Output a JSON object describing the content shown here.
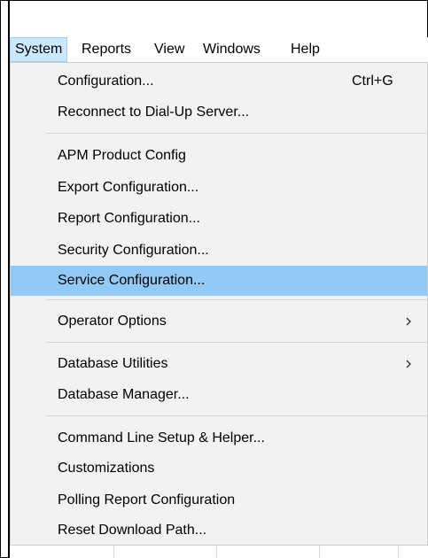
{
  "menubar": {
    "items": [
      {
        "label": "System",
        "open": true
      },
      {
        "label": "Reports",
        "open": false
      },
      {
        "label": "View",
        "open": false
      },
      {
        "label": "Windows",
        "open": false
      },
      {
        "label": "Help",
        "open": false
      }
    ]
  },
  "system_menu": {
    "items": [
      {
        "label": "Configuration...",
        "shortcut": "Ctrl+G"
      },
      {
        "label": "Reconnect to Dial-Up Server..."
      },
      {
        "label": "APM Product Config"
      },
      {
        "label": "Export Configuration..."
      },
      {
        "label": "Report Configuration..."
      },
      {
        "label": "Security Configuration..."
      },
      {
        "label": "Service Configuration...",
        "highlighted": true
      },
      {
        "label": "Operator Options",
        "submenu_icon": "chevron-right-icon"
      },
      {
        "label": "Database Utilities",
        "submenu_icon": "chevron-right-icon"
      },
      {
        "label": "Database Manager..."
      },
      {
        "label": "Command Line Setup & Helper..."
      },
      {
        "label": "Customizations"
      },
      {
        "label": "Polling Report Configuration"
      },
      {
        "label": "Reset Download Path..."
      }
    ]
  },
  "colors": {
    "menu_background": "#f2f2f2",
    "highlight": "#91c9f7",
    "open_menu_header": "#cce8ff",
    "separator": "#d4d4d4"
  }
}
